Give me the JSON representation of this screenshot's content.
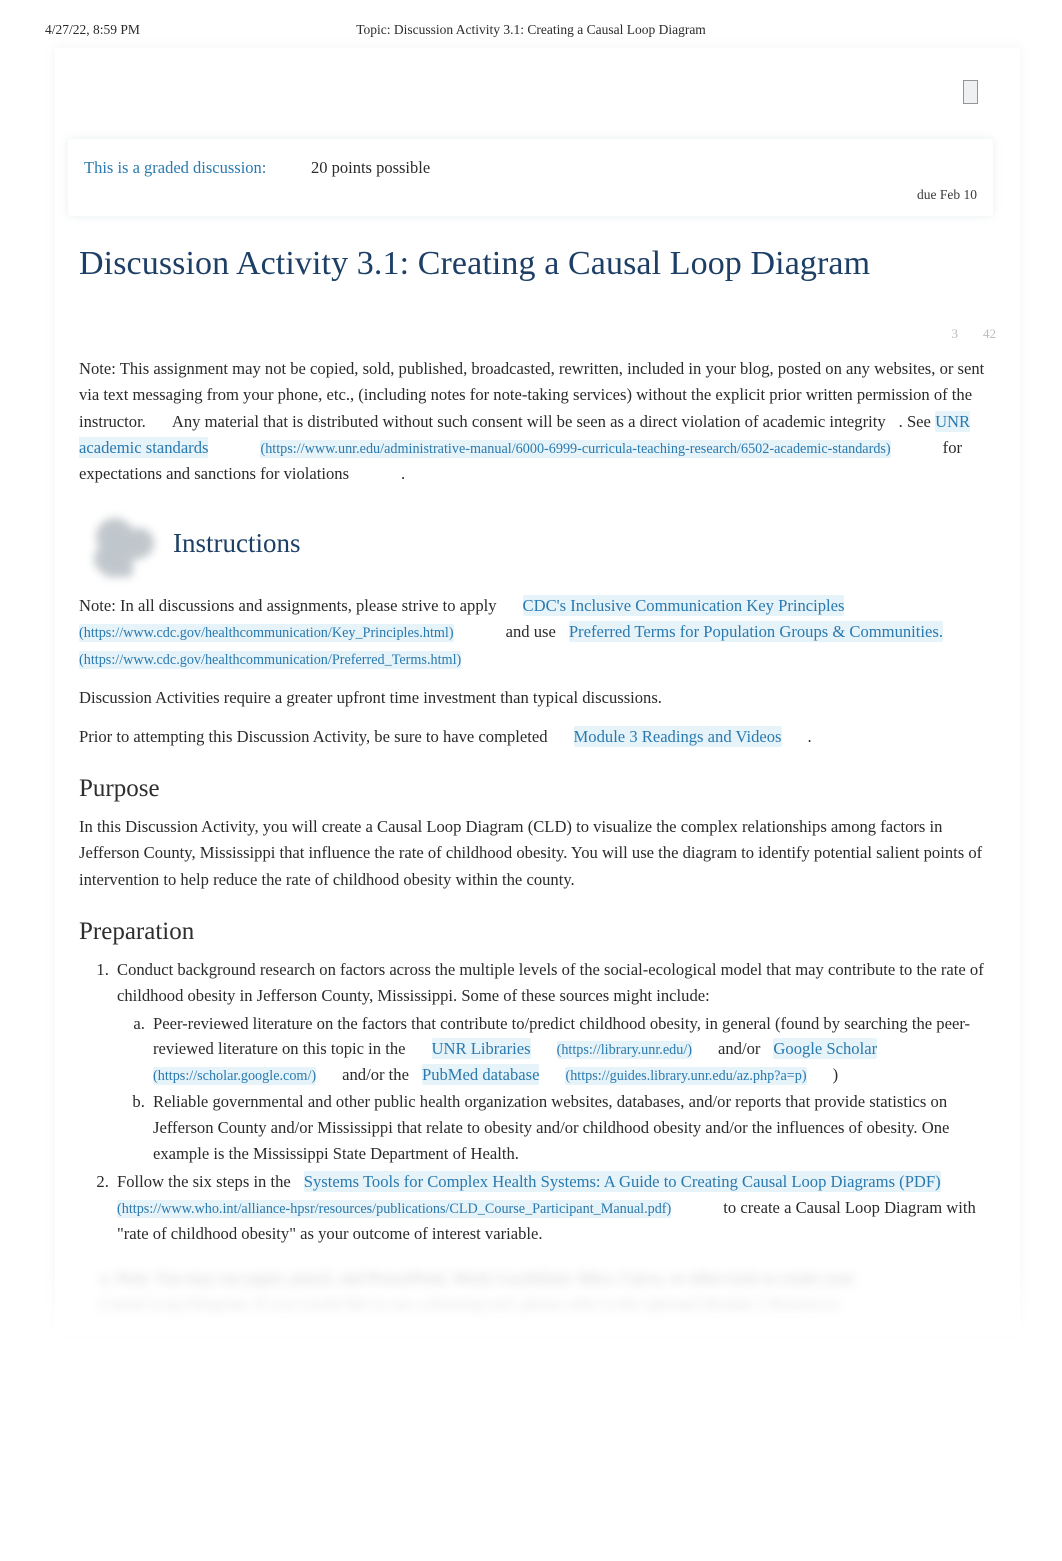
{
  "print_header": {
    "date": "4/27/22, 8:59 PM",
    "topic": "Topic: Discussion Activity 3.1: Creating a Causal Loop Diagram"
  },
  "banner": {
    "graded_label": "This is a graded discussion:",
    "points": "20 points possible",
    "due": "due Feb 10"
  },
  "title": "Discussion Activity 3.1: Creating a Causal Loop Diagram",
  "counters": {
    "replies": "3",
    "views": "42"
  },
  "academic_note": {
    "part1": "Note:  This assignment may not be copied, sold, published, broadcasted, rewritten, included in your blog, posted on any websites, or sent via text messaging from your phone, etc., (including notes for note-taking services) without the explicit prior written permission of the instructor.",
    "part2": "Any material that is distributed without such consent will be seen as a direct violation of academic integrity",
    "part3": ". See",
    "link_text": "UNR academic standards",
    "link_url": "(https://www.unr.edu/administrative-manual/6000-6999-curricula-teaching-research/6502-academic-standards)",
    "part4": "for expectations and sanctions for violations",
    "part5": "."
  },
  "instructions": {
    "heading": "Instructions",
    "icon": "puzzle-blob-icon",
    "note_part1": "Note:  In all discussions and assignments, please strive to apply",
    "cdc_link_text": "CDC's Inclusive Communication Key Principles",
    "cdc_link_url": "(https://www.cdc.gov/healthcommunication/Key_Principles.html)",
    "note_part2": "and use",
    "preferred_link_text": "Preferred Terms for Population Groups & Communities.",
    "preferred_link_url": "(https://www.cdc.gov/healthcommunication/Preferred_Terms.html)",
    "para_time": "Discussion Activities require a greater upfront time investment than typical discussions.",
    "para_prior_prefix": "Prior to attempting this Discussion Activity, be sure to have completed",
    "module_link_text": "Module 3 Readings and Videos",
    "para_prior_suffix": "."
  },
  "purpose": {
    "heading": "Purpose",
    "body": "In this Discussion Activity, you will create a Causal Loop Diagram (CLD) to visualize the complex relationships among factors in Jefferson County, Mississippi that influence the rate of childhood obesity. You will use the diagram to identify potential salient points of intervention to help reduce the rate of childhood obesity within the county."
  },
  "preparation": {
    "heading": "Preparation",
    "item1": "Conduct background research on factors across the multiple levels of the social-ecological model that may contribute to the rate of childhood obesity in Jefferson County, Mississippi. Some of these sources might include:",
    "item1a_part1": "Peer-reviewed literature on the factors that contribute to/predict childhood obesity, in general (found by searching the peer-reviewed literature on this topic in the",
    "item1a_unr_link": "UNR Libraries",
    "item1a_unr_url": "(https://library.unr.edu/)",
    "item1a_part2": "and/or",
    "item1a_scholar_link": "Google Scholar",
    "item1a_scholar_url": "(https://scholar.google.com/)",
    "item1a_part3": "and/or the",
    "item1a_pubmed_link": "PubMed database",
    "item1a_pubmed_url": "(https://guides.library.unr.edu/az.php?a=p)",
    "item1a_part4": ")",
    "item1b": "Reliable governmental and other public health organization websites, databases, and/or reports that provide statistics on Jefferson County and/or Mississippi that relate to obesity and/or childhood obesity and/or the influences of obesity. One example is the Mississippi State Department of Health.",
    "item2_prefix": "Follow the six steps in the",
    "item2_link_text": "Systems Tools for Complex Health Systems: A Guide to Creating Causal Loop Diagrams (PDF)",
    "item2_link_url": "(https://www.who.int/alliance-hpsr/resources/publications/CLD_Course_Participant_Manual.pdf)",
    "item2_mid": "to",
    "item2_suffix": "create a Causal Loop Diagram with \"rate of childhood obesity\" as your outcome of interest variable."
  },
  "colors": {
    "title_navy": "#1d3f66",
    "link_blue": "#2a7ab0",
    "body_text": "#2b2b2b",
    "counter_gray": "#b9bdc0",
    "highlight": "#d2e9f3"
  }
}
